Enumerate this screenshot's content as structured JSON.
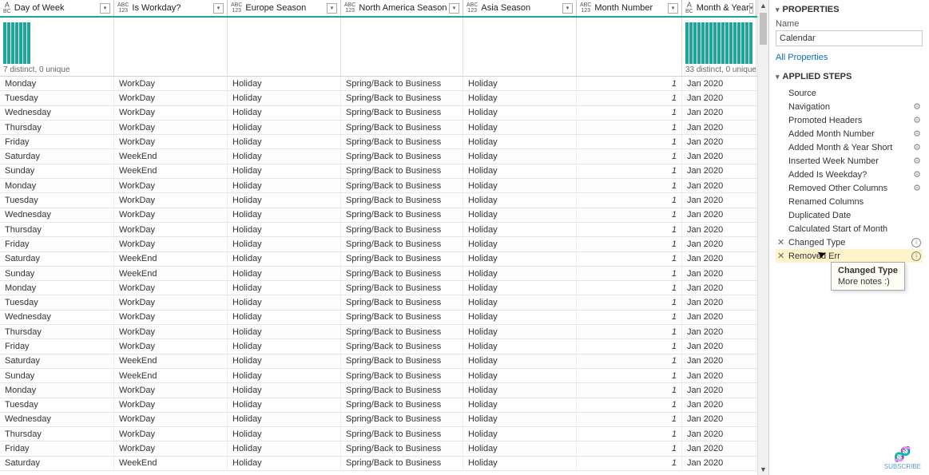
{
  "columns": [
    {
      "name": "Day of Week",
      "type": "text",
      "w": "c0",
      "stats": "7 distinct, 0 unique",
      "bars": 7
    },
    {
      "name": "Is Workday?",
      "type": "abc",
      "w": "c1",
      "stats": "",
      "bars": 0
    },
    {
      "name": "Europe Season",
      "type": "abc",
      "w": "c2",
      "stats": "",
      "bars": 0
    },
    {
      "name": "North America Season",
      "type": "abc",
      "w": "c3",
      "stats": "",
      "bars": 0
    },
    {
      "name": "Asia Season",
      "type": "abc",
      "w": "c4",
      "stats": "",
      "bars": 0
    },
    {
      "name": "Month Number",
      "type": "abc",
      "w": "c5",
      "stats": "",
      "bars": 0
    },
    {
      "name": "Month & Year",
      "type": "text",
      "w": "c6",
      "stats": "33 distinct, 0 unique",
      "bars": 18
    }
  ],
  "rows": [
    {
      "day": "Monday",
      "work": "WorkDay",
      "eur": "Holiday",
      "na": "Spring/Back to Business",
      "asia": "Holiday",
      "mnum": "1",
      "my": "Jan 2020"
    },
    {
      "day": "Tuesday",
      "work": "WorkDay",
      "eur": "Holiday",
      "na": "Spring/Back to Business",
      "asia": "Holiday",
      "mnum": "1",
      "my": "Jan 2020"
    },
    {
      "day": "Wednesday",
      "work": "WorkDay",
      "eur": "Holiday",
      "na": "Spring/Back to Business",
      "asia": "Holiday",
      "mnum": "1",
      "my": "Jan 2020"
    },
    {
      "day": "Thursday",
      "work": "WorkDay",
      "eur": "Holiday",
      "na": "Spring/Back to Business",
      "asia": "Holiday",
      "mnum": "1",
      "my": "Jan 2020"
    },
    {
      "day": "Friday",
      "work": "WorkDay",
      "eur": "Holiday",
      "na": "Spring/Back to Business",
      "asia": "Holiday",
      "mnum": "1",
      "my": "Jan 2020"
    },
    {
      "day": "Saturday",
      "work": "WeekEnd",
      "eur": "Holiday",
      "na": "Spring/Back to Business",
      "asia": "Holiday",
      "mnum": "1",
      "my": "Jan 2020"
    },
    {
      "day": "Sunday",
      "work": "WeekEnd",
      "eur": "Holiday",
      "na": "Spring/Back to Business",
      "asia": "Holiday",
      "mnum": "1",
      "my": "Jan 2020"
    },
    {
      "day": "Monday",
      "work": "WorkDay",
      "eur": "Holiday",
      "na": "Spring/Back to Business",
      "asia": "Holiday",
      "mnum": "1",
      "my": "Jan 2020"
    },
    {
      "day": "Tuesday",
      "work": "WorkDay",
      "eur": "Holiday",
      "na": "Spring/Back to Business",
      "asia": "Holiday",
      "mnum": "1",
      "my": "Jan 2020"
    },
    {
      "day": "Wednesday",
      "work": "WorkDay",
      "eur": "Holiday",
      "na": "Spring/Back to Business",
      "asia": "Holiday",
      "mnum": "1",
      "my": "Jan 2020"
    },
    {
      "day": "Thursday",
      "work": "WorkDay",
      "eur": "Holiday",
      "na": "Spring/Back to Business",
      "asia": "Holiday",
      "mnum": "1",
      "my": "Jan 2020"
    },
    {
      "day": "Friday",
      "work": "WorkDay",
      "eur": "Holiday",
      "na": "Spring/Back to Business",
      "asia": "Holiday",
      "mnum": "1",
      "my": "Jan 2020"
    },
    {
      "day": "Saturday",
      "work": "WeekEnd",
      "eur": "Holiday",
      "na": "Spring/Back to Business",
      "asia": "Holiday",
      "mnum": "1",
      "my": "Jan 2020"
    },
    {
      "day": "Sunday",
      "work": "WeekEnd",
      "eur": "Holiday",
      "na": "Spring/Back to Business",
      "asia": "Holiday",
      "mnum": "1",
      "my": "Jan 2020"
    },
    {
      "day": "Monday",
      "work": "WorkDay",
      "eur": "Holiday",
      "na": "Spring/Back to Business",
      "asia": "Holiday",
      "mnum": "1",
      "my": "Jan 2020"
    },
    {
      "day": "Tuesday",
      "work": "WorkDay",
      "eur": "Holiday",
      "na": "Spring/Back to Business",
      "asia": "Holiday",
      "mnum": "1",
      "my": "Jan 2020"
    },
    {
      "day": "Wednesday",
      "work": "WorkDay",
      "eur": "Holiday",
      "na": "Spring/Back to Business",
      "asia": "Holiday",
      "mnum": "1",
      "my": "Jan 2020"
    },
    {
      "day": "Thursday",
      "work": "WorkDay",
      "eur": "Holiday",
      "na": "Spring/Back to Business",
      "asia": "Holiday",
      "mnum": "1",
      "my": "Jan 2020"
    },
    {
      "day": "Friday",
      "work": "WorkDay",
      "eur": "Holiday",
      "na": "Spring/Back to Business",
      "asia": "Holiday",
      "mnum": "1",
      "my": "Jan 2020"
    },
    {
      "day": "Saturday",
      "work": "WeekEnd",
      "eur": "Holiday",
      "na": "Spring/Back to Business",
      "asia": "Holiday",
      "mnum": "1",
      "my": "Jan 2020"
    },
    {
      "day": "Sunday",
      "work": "WeekEnd",
      "eur": "Holiday",
      "na": "Spring/Back to Business",
      "asia": "Holiday",
      "mnum": "1",
      "my": "Jan 2020"
    },
    {
      "day": "Monday",
      "work": "WorkDay",
      "eur": "Holiday",
      "na": "Spring/Back to Business",
      "asia": "Holiday",
      "mnum": "1",
      "my": "Jan 2020"
    },
    {
      "day": "Tuesday",
      "work": "WorkDay",
      "eur": "Holiday",
      "na": "Spring/Back to Business",
      "asia": "Holiday",
      "mnum": "1",
      "my": "Jan 2020"
    },
    {
      "day": "Wednesday",
      "work": "WorkDay",
      "eur": "Holiday",
      "na": "Spring/Back to Business",
      "asia": "Holiday",
      "mnum": "1",
      "my": "Jan 2020"
    },
    {
      "day": "Thursday",
      "work": "WorkDay",
      "eur": "Holiday",
      "na": "Spring/Back to Business",
      "asia": "Holiday",
      "mnum": "1",
      "my": "Jan 2020"
    },
    {
      "day": "Friday",
      "work": "WorkDay",
      "eur": "Holiday",
      "na": "Spring/Back to Business",
      "asia": "Holiday",
      "mnum": "1",
      "my": "Jan 2020"
    },
    {
      "day": "Saturday",
      "work": "WeekEnd",
      "eur": "Holiday",
      "na": "Spring/Back to Business",
      "asia": "Holiday",
      "mnum": "1",
      "my": "Jan 2020"
    }
  ],
  "properties": {
    "section_properties": "PROPERTIES",
    "name_label": "Name",
    "name_value": "Calendar",
    "all_props_link": "All Properties",
    "section_steps": "APPLIED STEPS"
  },
  "steps": [
    {
      "label": "Source",
      "gear": false,
      "x": false,
      "info": false,
      "selected": false
    },
    {
      "label": "Navigation",
      "gear": true,
      "x": false,
      "info": false,
      "selected": false
    },
    {
      "label": "Promoted Headers",
      "gear": true,
      "x": false,
      "info": false,
      "selected": false
    },
    {
      "label": "Added Month Number",
      "gear": true,
      "x": false,
      "info": false,
      "selected": false
    },
    {
      "label": "Added Month & Year Short",
      "gear": true,
      "x": false,
      "info": false,
      "selected": false
    },
    {
      "label": "Inserted Week Number",
      "gear": true,
      "x": false,
      "info": false,
      "selected": false
    },
    {
      "label": "Added Is Weekday?",
      "gear": true,
      "x": false,
      "info": false,
      "selected": false
    },
    {
      "label": "Removed Other Columns",
      "gear": true,
      "x": false,
      "info": false,
      "selected": false
    },
    {
      "label": "Renamed Columns",
      "gear": false,
      "x": false,
      "info": false,
      "selected": false
    },
    {
      "label": "Duplicated Date",
      "gear": false,
      "x": false,
      "info": false,
      "selected": false
    },
    {
      "label": "Calculated Start of Month",
      "gear": false,
      "x": false,
      "info": false,
      "selected": false
    },
    {
      "label": "Changed Type",
      "gear": false,
      "x": true,
      "info": true,
      "selected": false
    },
    {
      "label": "Removed Err",
      "gear": false,
      "x": true,
      "info": true,
      "selected": true
    }
  ],
  "tooltip": {
    "title": "Changed Type",
    "body": "More notes :)"
  },
  "subscribe": "SUBSCRIBE"
}
